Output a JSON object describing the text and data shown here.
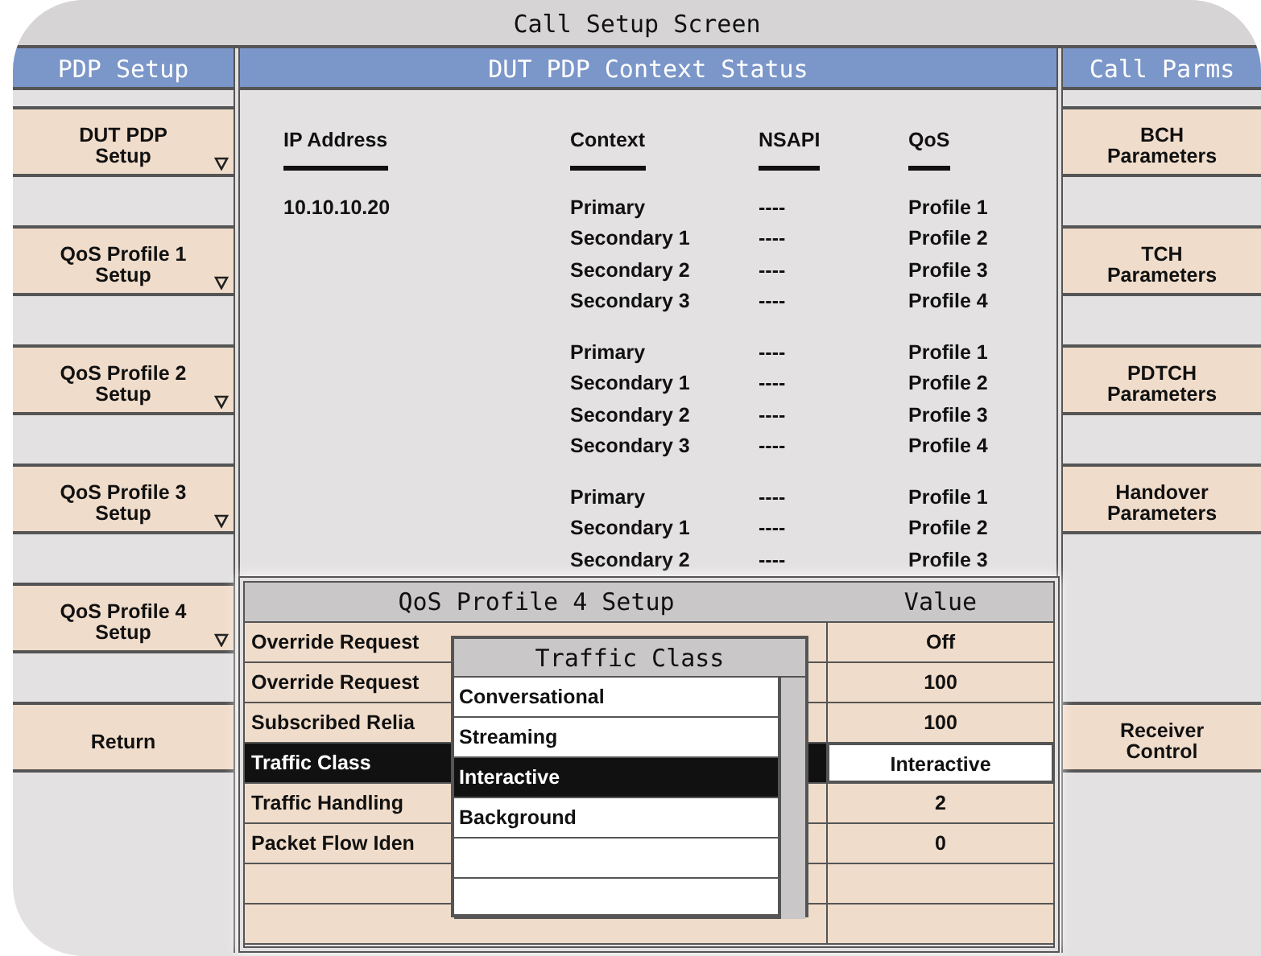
{
  "window": {
    "title": "Call Setup Screen"
  },
  "left_panel": {
    "title": "PDP Setup",
    "buttons": [
      {
        "kind": "softkey",
        "label": "DUT PDP\nSetup",
        "has_menu": true
      },
      {
        "kind": "softkey",
        "label": "QoS Profile 1\nSetup",
        "has_menu": true
      },
      {
        "kind": "softkey",
        "label": "QoS Profile 2\nSetup",
        "has_menu": true
      },
      {
        "kind": "softkey",
        "label": "QoS Profile 3\nSetup",
        "has_menu": true
      },
      {
        "kind": "softkey",
        "label": "QoS Profile 4\nSetup",
        "has_menu": true
      },
      {
        "kind": "softkey",
        "label": "Return",
        "has_menu": false
      }
    ]
  },
  "context_status": {
    "title": "DUT PDP Context Status",
    "columns": [
      "IP Address",
      "Context",
      "NSAPI",
      "QoS"
    ],
    "groups": [
      {
        "ip_address": "10.10.10.20",
        "rows": [
          {
            "context": "Primary",
            "nsapi": "----",
            "qos": "Profile 1"
          },
          {
            "context": "Secondary 1",
            "nsapi": "----",
            "qos": "Profile 2"
          },
          {
            "context": "Secondary 2",
            "nsapi": "----",
            "qos": "Profile 3"
          },
          {
            "context": "Secondary 3",
            "nsapi": "----",
            "qos": "Profile 4"
          }
        ]
      },
      {
        "rows": [
          {
            "context": "Primary",
            "nsapi": "----",
            "qos": "Profile 1"
          },
          {
            "context": "Secondary 1",
            "nsapi": "----",
            "qos": "Profile 2"
          },
          {
            "context": "Secondary 2",
            "nsapi": "----",
            "qos": "Profile 3"
          },
          {
            "context": "Secondary 3",
            "nsapi": "----",
            "qos": "Profile 4"
          }
        ]
      },
      {
        "rows": [
          {
            "context": "Primary",
            "nsapi": "----",
            "qos": "Profile 1"
          },
          {
            "context": "Secondary 1",
            "nsapi": "----",
            "qos": "Profile 2"
          },
          {
            "context": "Secondary 2",
            "nsapi": "----",
            "qos": "Profile 3"
          }
        ]
      }
    ]
  },
  "right_panel": {
    "title": "Call Parms",
    "buttons": [
      {
        "kind": "softkey",
        "label": "BCH\nParameters",
        "has_menu": false
      },
      {
        "kind": "softkey",
        "label": "TCH\nParameters",
        "has_menu": false
      },
      {
        "kind": "softkey",
        "label": "PDTCH\nParameters",
        "has_menu": false
      },
      {
        "kind": "softkey",
        "label": "Handover\nParameters",
        "has_menu": false
      },
      {
        "kind": "blank"
      },
      {
        "kind": "softkey",
        "label": "Receiver\nControl",
        "has_menu": false
      }
    ]
  },
  "setup_dialog": {
    "title": "QoS Profile 4 Setup",
    "value_heading": "Value",
    "rows": [
      {
        "parameter": "Override Request",
        "value": "Off",
        "selected": false
      },
      {
        "parameter": "Override Request",
        "value": "100",
        "selected": false
      },
      {
        "parameter": "Subscribed Relia",
        "value": "100",
        "selected": false
      },
      {
        "parameter": "Traffic Class",
        "value": "Interactive",
        "selected": true
      },
      {
        "parameter": "Traffic Handling",
        "value": "2",
        "selected": false
      },
      {
        "parameter": "Packet Flow Iden",
        "value": "0",
        "selected": false
      }
    ]
  },
  "selection_popup": {
    "title": "Traffic Class",
    "options": [
      {
        "label": "Conversational",
        "selected": false
      },
      {
        "label": "Streaming",
        "selected": false
      },
      {
        "label": "Interactive",
        "selected": true
      },
      {
        "label": "Background",
        "selected": false
      }
    ]
  }
}
